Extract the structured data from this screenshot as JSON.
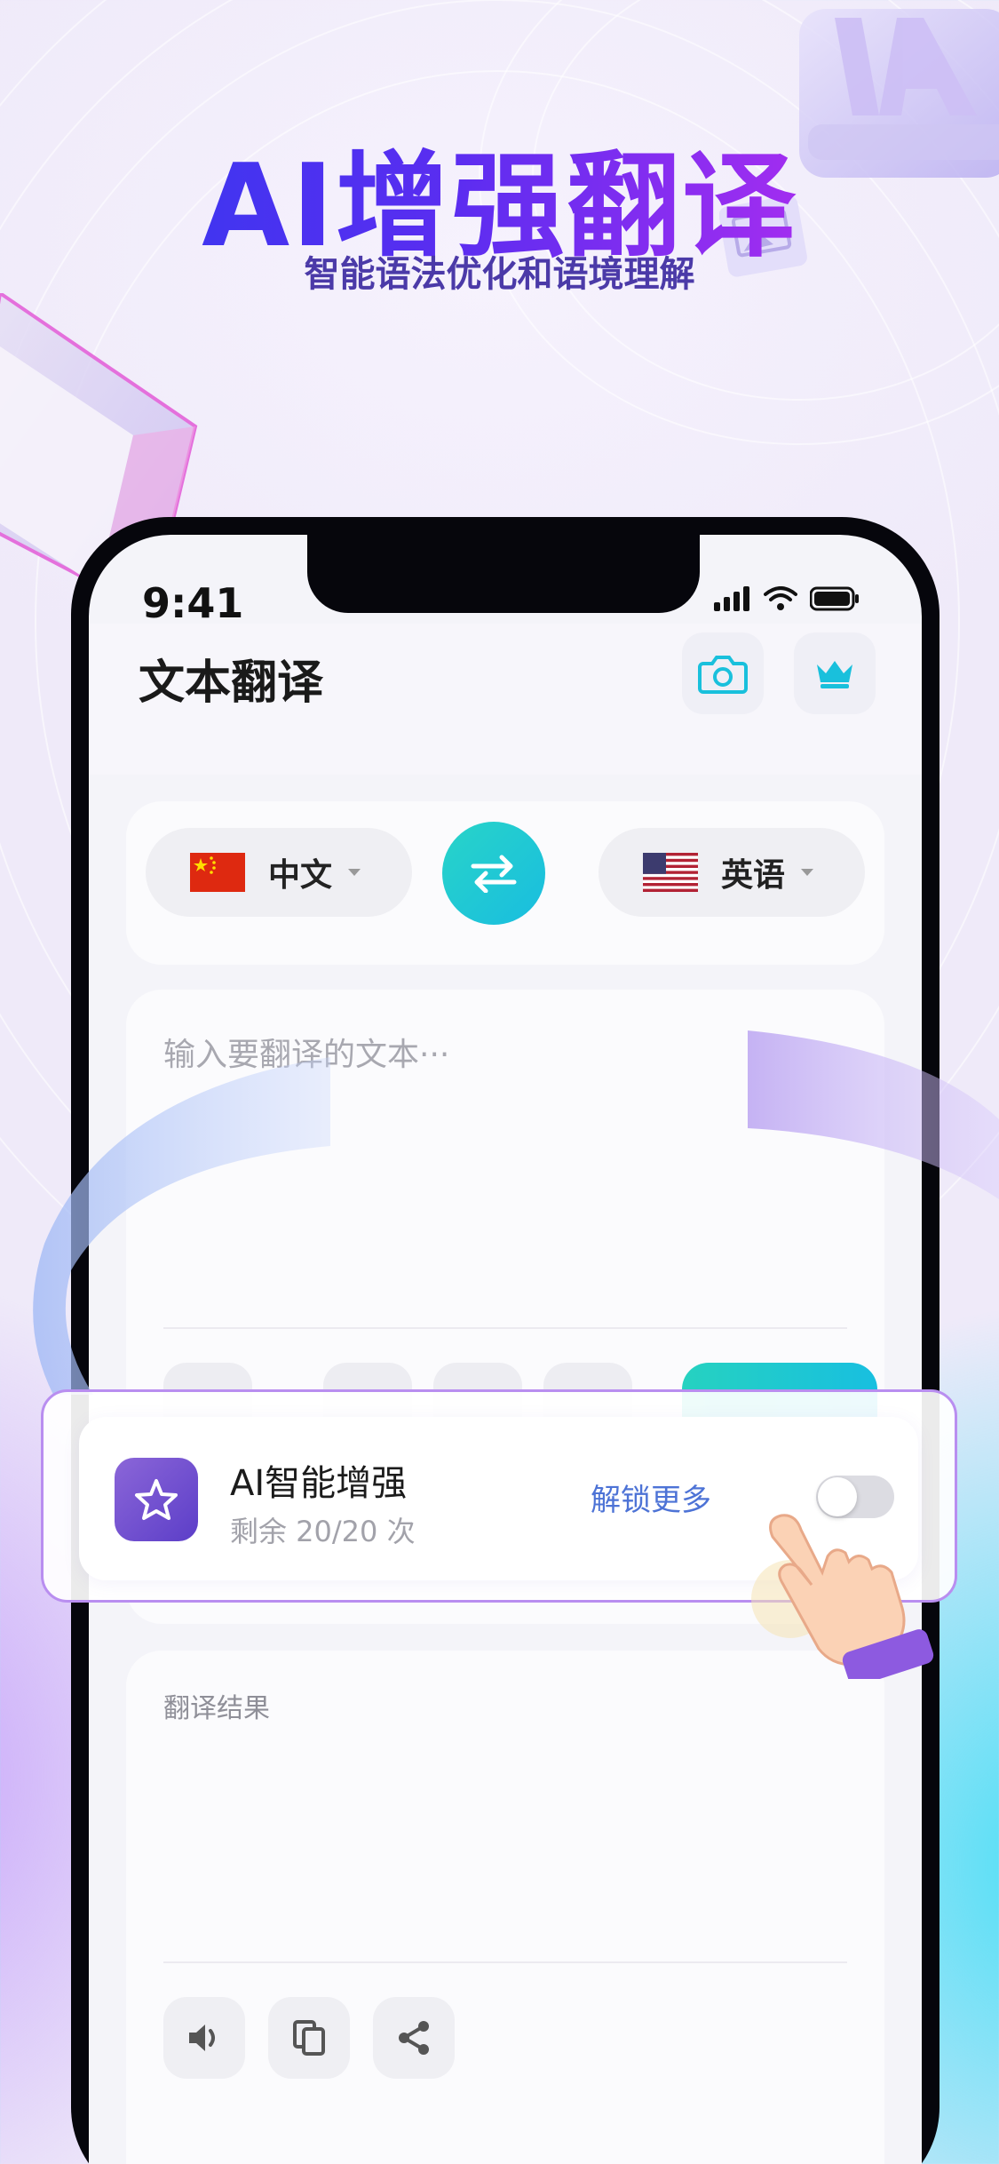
{
  "hero": {
    "title": "AI增强翻译",
    "subtitle": "智能语法优化和语境理解"
  },
  "status_bar": {
    "time": "9:41"
  },
  "app": {
    "title": "文本翻译",
    "camera_icon": "camera-icon",
    "crown_icon": "crown-icon"
  },
  "languages": {
    "source": "中文",
    "target": "英语",
    "swap_icon": "swap-arrows-icon"
  },
  "input": {
    "placeholder": "输入要翻译的文本···"
  },
  "ai_feature": {
    "title": "AI智能增强",
    "remaining": "剩余 20/20 次",
    "unlock": "解锁更多",
    "enabled": false
  },
  "result": {
    "label": "翻译结果",
    "actions": [
      "speaker-icon",
      "copy-icon",
      "share-icon"
    ]
  },
  "colors": {
    "accent_teal": "#1fc9d4",
    "link_blue": "#4d73d6",
    "ai_purple": "#6a4fd0",
    "title_gradient_start": "#2d3bf0",
    "title_gradient_end": "#c23cf0"
  }
}
